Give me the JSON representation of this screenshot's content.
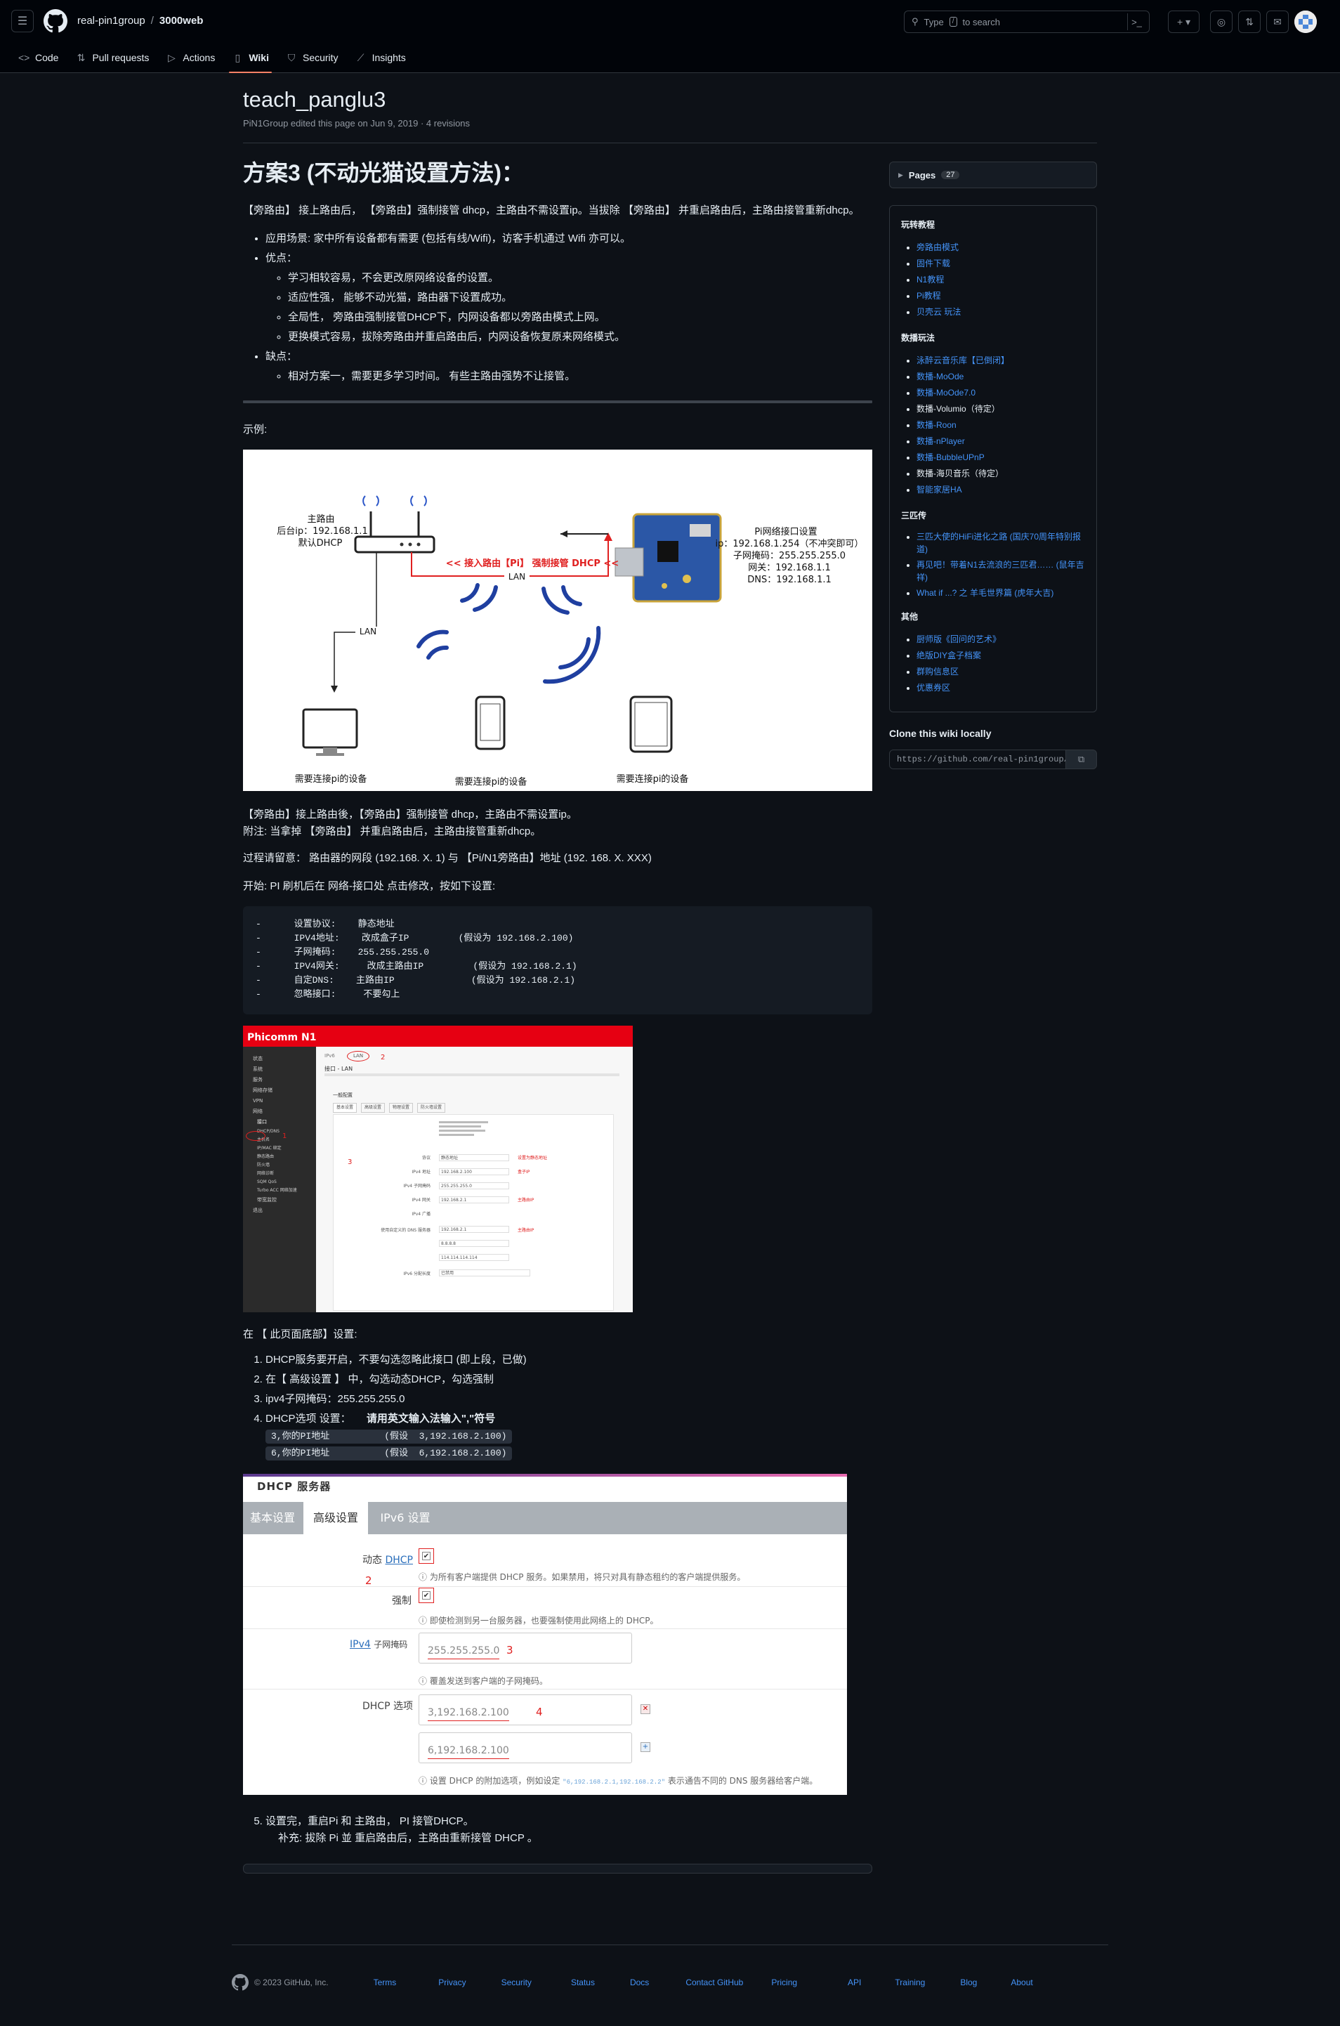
{
  "header": {
    "owner": "real-pin1group",
    "separator": "/",
    "repo": "3000web",
    "search_prefix": "Type",
    "search_key": "/",
    "search_suffix": "to search",
    "cmd_icon": "terminal-icon"
  },
  "nav": {
    "tabs": [
      {
        "label": "Code",
        "icon": "code-icon"
      },
      {
        "label": "Pull requests",
        "icon": "pull-request-icon"
      },
      {
        "label": "Actions",
        "icon": "play-icon"
      },
      {
        "label": "Wiki",
        "icon": "book-icon"
      },
      {
        "label": "Security",
        "icon": "shield-icon"
      },
      {
        "label": "Insights",
        "icon": "graph-icon"
      }
    ],
    "active": "Wiki"
  },
  "wiki": {
    "title": "teach_panglu3",
    "meta": "PiN1Group edited this page on Jun 9, 2019 · 4 revisions"
  },
  "article": {
    "heading": "方案3 (不动光猫设置方法)：",
    "intro": "【旁路由】 接上路由后， 【旁路由】强制接管 dhcp，主路由不需设置ip。当拔除 【旁路由】 并重启路由后，主路由接管重新dhcp。",
    "bullet_scene": "应用场景: 家中所有设备都有需要 (包括有线/Wifi)，访客手机通过 Wifi 亦可以。",
    "bullet_pros": "优点：",
    "pros": [
      "学习相较容易，不会更改原网络设备的设置。",
      "适应性强， 能够不动光猫，路由器下设置成功。",
      "全局性， 旁路由强制接管DHCP下，内网设备都以旁路由模式上网。",
      "更换模式容易，拔除旁路由并重启路由后，内网设备恢复原来网络模式。"
    ],
    "bullet_cons": "缺点：",
    "cons": [
      "相对方案一，需要更多学习时间。 有些主路由强势不让接管。"
    ],
    "example_label": "示例:",
    "after_diagram_1": "【旁路由】接上路由後，【旁路由】强制接管 dhcp，主路由不需设置ip。",
    "after_diagram_2": "附注: 当拿掉 【旁路由】 并重启路由后，主路由接管重新dhcp。",
    "notice": "过程请留意： 路由器的网段 (192.168. X. 1) 与 【Pi/N1旁路由】地址 (192. 168. X. XXX)",
    "start": "开始: PI 刷机后在 网络-接口处 点击修改，按如下设置:",
    "code": "-      设置协议:    静态地址\n-      IPV4地址:    改成盒子IP         (假设为 192.168.2.100)\n-      子网掩码:    255.255.255.0\n-      IPV4网关:     改成主路由IP         (假设为 192.168.2.1)\n-      自定DNS:    主路由IP              (假设为 192.168.2.1)\n-      忽略接口:     不要勾上",
    "bottom_settings": "在 【 此页面底部】设置:",
    "steps": [
      "DHCP服务要开启，不要勾选忽略此接口 (即上段，已做)",
      "在【 高级设置 】 中，勾选动态DHCP，勾选强制",
      "ipv4子网掩码：255.255.255.0"
    ],
    "step4_prefix": "DHCP选项 设置：",
    "step4_bold": "请用英文输入法输入\",\"符号",
    "dhcp_opts": [
      "3,你的PI地址          (假设  3,192.168.2.100)",
      "6,你的PI地址          (假设  6,192.168.2.100)"
    ],
    "step5": "设置完，重启Pi 和 主路由， PI 接管DHCP。",
    "step5_note": "补充: 拔除 Pi 並 重启路由后，主路由重新接管 DHCP 。"
  },
  "diagram": {
    "main_router": "主路由",
    "main_router_ip": "后台ip：192.168.1.1",
    "main_router_dhcp": "默认DHCP",
    "arrow_label": "<< 接入路由【Pi】 强制接管 DHCP <<",
    "lan1": "LAN",
    "lan2": "LAN",
    "pi_title": "Pi网络接口设置",
    "pi_ip": "ip：192.168.1.254（不冲突即可）",
    "pi_mask": "子网掩码：255.255.255.0",
    "pi_gw": "网关：192.168.1.1",
    "pi_dns": "DNS：192.168.1.1",
    "dev1": "需要连接pi的设备",
    "dev2": "需要连接pi的设备",
    "dev3": "需要连接pi的设备"
  },
  "n1shot": {
    "brand": "Phicomm N1",
    "tab1": "IPv6",
    "tab2": "LAN",
    "mark1": "1",
    "mark2": "2",
    "mark3": "3",
    "title": "接口 - LAN",
    "section": "一般配置",
    "subtabs": [
      "基本设置",
      "高级设置",
      "物理设置",
      "防火墙设置"
    ],
    "rows": [
      "状态",
      "协议",
      "IPv4 地址",
      "IPv4 子网掩码",
      "IPv4 网关",
      "IPv4 广播",
      "使用自定义的 DNS 服务器",
      "IPv6 分配长度"
    ],
    "values": [
      "静态地址",
      "192.168.2.100",
      "255.255.255.0",
      "192.168.2.1",
      "",
      "192.168.2.1",
      "8.8.8.8",
      "114.114.114.114",
      "已禁用"
    ],
    "notes": [
      "设置为静态地址",
      "盒子IP",
      "主路由IP",
      "主路由IP"
    ],
    "menu": [
      "状态",
      "系统",
      "服务",
      "网络存储",
      "VPN",
      "网络",
      "接口",
      "DHCP/DNS",
      "主机名",
      "IP/MAC 绑定",
      "静态路由",
      "防火墙",
      "网络诊断",
      "SQM QoS",
      "Turbo ACC 网络加速",
      "带宽监控",
      "退出"
    ]
  },
  "dhcpshot": {
    "title": "DHCP 服务器",
    "tabs": [
      "基本设置",
      "高级设置",
      "IPv6 设置"
    ],
    "dyn_label": "动态",
    "dyn_link": "DHCP",
    "dyn_help": "为所有客户端提供 DHCP 服务。如果禁用，将只对具有静态租约的客户端提供服务。",
    "force_label": "强制",
    "force_help": "即使检测到另一台服务器，也要强制使用此网络上的 DHCP。",
    "mask_link": "IPv4",
    "mask_label": "子网掩码",
    "mask_value": "255.255.255.0",
    "mask_help": "覆盖发送到客户端的子网掩码。",
    "opt_label": "DHCP 选项",
    "opt1": "3,192.168.2.100",
    "opt2": "6,192.168.2.100",
    "opt_help_a": "设置 DHCP 的附加选项，例如设定",
    "opt_help_code": "\"6,192.168.2.1,192.168.2.2\"",
    "opt_help_b": "表示通告不同的 DNS 服务器给客户端。",
    "mark2": "2",
    "mark3": "3",
    "mark4": "4"
  },
  "sidebar": {
    "pages_label": "Pages",
    "pages_count": "27",
    "groups": [
      {
        "title": "玩转教程",
        "items": [
          {
            "text": "旁路由模式",
            "link": true
          },
          {
            "text": "固件下载",
            "link": true
          },
          {
            "text": "N1教程",
            "link": true
          },
          {
            "text": "Pi教程",
            "link": true
          },
          {
            "text": "贝壳云 玩法",
            "link": true
          }
        ]
      },
      {
        "title": "数播玩法",
        "items": [
          {
            "text": "泳醉云音乐库【已倒闭】",
            "link": true
          },
          {
            "text": "数播-MoOde",
            "link": true
          },
          {
            "text": "数播-MoOde7.0",
            "link": true
          },
          {
            "text": "数播-Volumio（待定）",
            "link": false
          },
          {
            "text": "数播-Roon",
            "link": true
          },
          {
            "text": "数播-nPlayer",
            "link": true
          },
          {
            "text": "数播-BubbleUPnP",
            "link": true
          },
          {
            "text": "数播-海贝音乐（待定）",
            "link": false
          },
          {
            "text": "智能家居HA",
            "link": true
          }
        ]
      },
      {
        "title": "三匹传",
        "items": [
          {
            "text": "三匹大使的HiFi进化之路 (国庆70周年特别报道)",
            "link": true
          },
          {
            "text": "再见吧！带着N1去流浪的三匹君…… (鼠年吉祥)",
            "link": true
          },
          {
            "text": "What if ...? 之 羊毛世界篇 (虎年大吉)",
            "link": true
          }
        ]
      },
      {
        "title": "其他",
        "items": [
          {
            "text": "厨师版《回问的艺术》",
            "link": true
          },
          {
            "text": "绝版DIY盒子档案",
            "link": true
          },
          {
            "text": "群购信息区",
            "link": true
          },
          {
            "text": "优惠券区",
            "link": true
          }
        ]
      }
    ],
    "clone_title": "Clone this wiki locally",
    "clone_url": "https://github.com/real-pin1group/3000web.wiki.git",
    "copy_icon": "copy-icon"
  },
  "footer": {
    "copyright": "© 2023 GitHub, Inc.",
    "links": [
      "Terms",
      "Privacy",
      "Security",
      "Status",
      "Docs",
      "Contact GitHub",
      "Pricing",
      "API",
      "Training",
      "Blog",
      "About"
    ]
  },
  "colors": {
    "bg": "#0d1117",
    "header_bg": "#010409",
    "link": "#4493f8",
    "active_tab": "#f78166",
    "phicomm_red": "#e60012",
    "annotation_red": "#e02020",
    "wave_blue": "#1f3fa0"
  }
}
